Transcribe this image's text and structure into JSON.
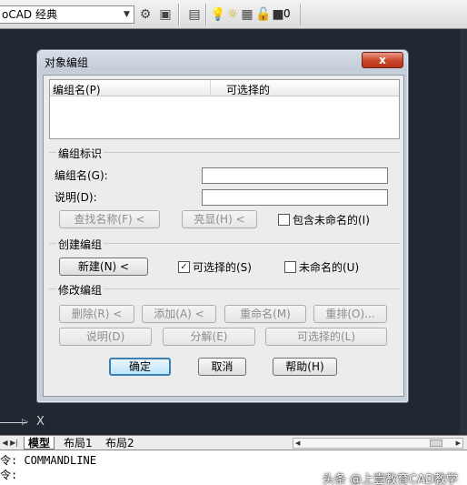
{
  "toolbar": {
    "workspace_value": "oCAD 经典",
    "layer_name": "0"
  },
  "dialog": {
    "title": "对象编组",
    "close_glyph": "x",
    "list": {
      "col_name": "编组名(P)",
      "col_selectable": "可选择的"
    },
    "identify": {
      "title": "编组标识",
      "name_label": "编组名(G):",
      "name_value": "",
      "desc_label": "说明(D):",
      "desc_value": "",
      "find_button": "查找名称(F) <",
      "highlight_button": "亮显(H) <",
      "include_unnamed_label": "包含未命名的(I)",
      "include_unnamed_checked": false
    },
    "create": {
      "title": "创建编组",
      "new_button": "新建(N) <",
      "selectable_label": "可选择的(S)",
      "selectable_checked": true,
      "unnamed_label": "未命名的(U)",
      "unnamed_checked": false
    },
    "modify": {
      "title": "修改编组",
      "remove_button": "删除(R) <",
      "add_button": "添加(A) <",
      "rename_button": "重命名(M)",
      "reorder_button": "重排(O)...",
      "description_button": "说明(D)",
      "explode_button": "分解(E)",
      "selectable_button": "可选择的(L)"
    },
    "ok_button": "确定",
    "cancel_button": "取消",
    "help_button": "帮助(H)"
  },
  "ucs": {
    "x_label": "X"
  },
  "tabs": [
    "模型",
    "布局1",
    "布局2"
  ],
  "command": {
    "line1": "令: COMMANDLINE",
    "line2": "令:"
  },
  "watermark": "头条 @上壹教育CAD教学"
}
